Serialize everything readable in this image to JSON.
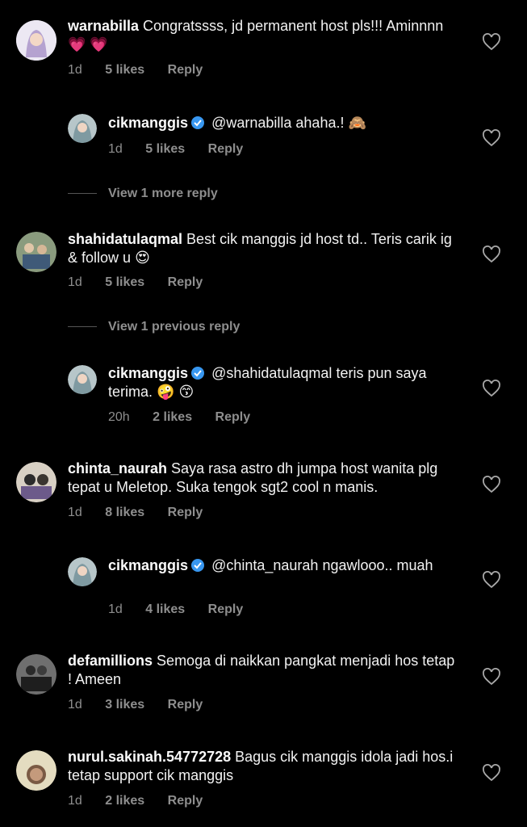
{
  "comments": [
    {
      "user": "warnabilla",
      "text": "Congratssss, jd permanent host pls!!! Aminnnn",
      "emojis": "💗 💗",
      "time": "1d",
      "likes": "5 likes",
      "reply": "Reply"
    },
    {
      "user": "cikmanggis",
      "mention": "@warnabilla",
      "text": "ahaha.!",
      "emojis": "🙈",
      "time": "1d",
      "likes": "5 likes",
      "reply": "Reply"
    },
    {
      "view_more": "View 1 more reply"
    },
    {
      "user": "shahidatulaqmal",
      "text": "Best cik manggis jd host td.. Teris carik ig & follow u",
      "emojis": "😍",
      "time": "1d",
      "likes": "5 likes",
      "reply": "Reply"
    },
    {
      "view_more": "View 1 previous reply"
    },
    {
      "user": "cikmanggis",
      "mention": "@shahidatulaqmal",
      "text": "teris pun saya terima.",
      "emojis": "🤪 😙",
      "time": "20h",
      "likes": "2 likes",
      "reply": "Reply"
    },
    {
      "user": "chinta_naurah",
      "text": "Saya rasa astro dh jumpa host wanita plg tepat u Meletop. Suka tengok sgt2 cool n manis.",
      "time": "1d",
      "likes": "8 likes",
      "reply": "Reply"
    },
    {
      "user": "cikmanggis",
      "mention": "@chinta_naurah",
      "text": "ngawlooo.. muah",
      "time": "1d",
      "likes": "4 likes",
      "reply": "Reply"
    },
    {
      "user": "defamillions",
      "text": "Semoga di naikkan pangkat menjadi hos tetap ! Ameen",
      "time": "1d",
      "likes": "3 likes",
      "reply": "Reply"
    },
    {
      "user": "nurul.sakinah.54772728",
      "text": "Bagus cik manggis idola jadi hos.i tetap support cik manggis",
      "time": "1d",
      "likes": "2 likes",
      "reply": "Reply"
    }
  ]
}
